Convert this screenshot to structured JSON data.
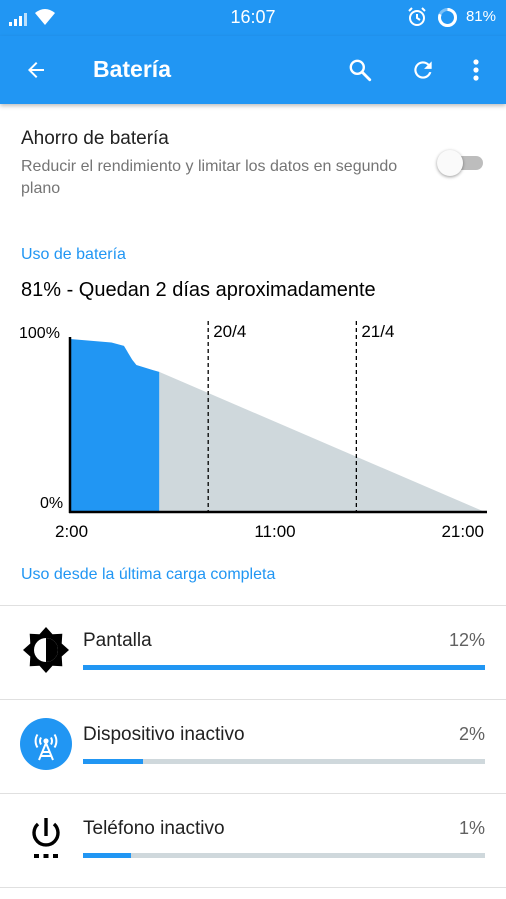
{
  "status_bar": {
    "time": "16:07",
    "battery_percent": "81%",
    "icons": [
      "signal-icon",
      "wifi-icon",
      "alarm-icon",
      "battery-ring-icon"
    ]
  },
  "app_bar": {
    "title": "Batería",
    "icons": [
      "back-arrow-icon",
      "search-icon",
      "refresh-icon",
      "more-vert-icon"
    ]
  },
  "battery_saver": {
    "title": "Ahorro de batería",
    "description": "Reducir el rendimiento y limitar los datos en segundo plano",
    "enabled": false
  },
  "usage_section": {
    "header": "Uso de batería",
    "summary": "81% - Quedan 2 días aproximadamente"
  },
  "chart_data": {
    "type": "area",
    "y_tick_labels": [
      "100%",
      "0%"
    ],
    "x_tick_labels": [
      "2:00",
      "11:00",
      "21:00"
    ],
    "day_markers": [
      "20/4",
      "21/4"
    ],
    "history_color": "#2196f3",
    "projection_color": "#cfd8dc",
    "history_series": {
      "x_fraction_of_span": [
        0.0,
        0.1,
        0.13,
        0.14,
        0.15,
        0.16,
        0.2,
        0.215
      ],
      "percent": [
        100,
        98,
        96,
        92,
        88,
        85,
        82,
        81
      ]
    },
    "projection_series": {
      "x_fraction_of_span": [
        0.215,
        1.0
      ],
      "percent": [
        81,
        0
      ]
    },
    "marker_fraction": [
      0.333,
      0.69
    ]
  },
  "since_charge": {
    "header": "Uso desde la última carga completa",
    "items": [
      {
        "label": "Pantalla",
        "percent": "12%",
        "fraction": 1.0,
        "icon": "brightness-icon"
      },
      {
        "label": "Dispositivo inactivo",
        "percent": "2%",
        "fraction": 0.15,
        "icon": "cell-tower-icon"
      },
      {
        "label": "Teléfono inactivo",
        "percent": "1%",
        "fraction": 0.12,
        "icon": "power-icon"
      }
    ]
  },
  "colors": {
    "accent": "#2196f3",
    "divider": "#e0e0e0",
    "secondary_text": "#757575"
  }
}
